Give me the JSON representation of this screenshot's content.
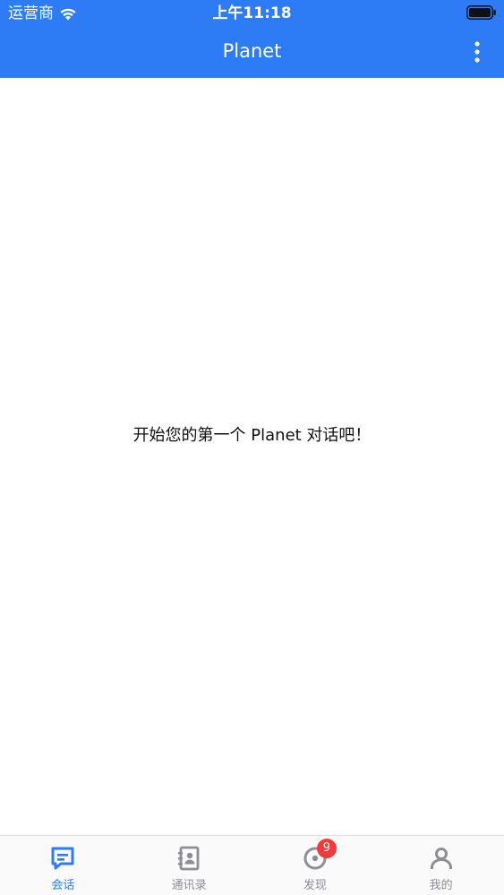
{
  "status_bar": {
    "carrier": "运营商",
    "time": "上午11:18"
  },
  "nav": {
    "title": "Planet"
  },
  "main": {
    "empty_message": "开始您的第一个 Planet 对话吧！"
  },
  "tabs": [
    {
      "label": "会话",
      "icon": "chat-icon",
      "active": true
    },
    {
      "label": "通讯录",
      "icon": "contacts-icon",
      "active": false
    },
    {
      "label": "发现",
      "icon": "discover-icon",
      "active": false,
      "badge": "9"
    },
    {
      "label": "我的",
      "icon": "profile-icon",
      "active": false
    }
  ],
  "colors": {
    "accent": "#2d7cf6",
    "inactive": "#8e8e93",
    "badge": "#f23b3b"
  }
}
